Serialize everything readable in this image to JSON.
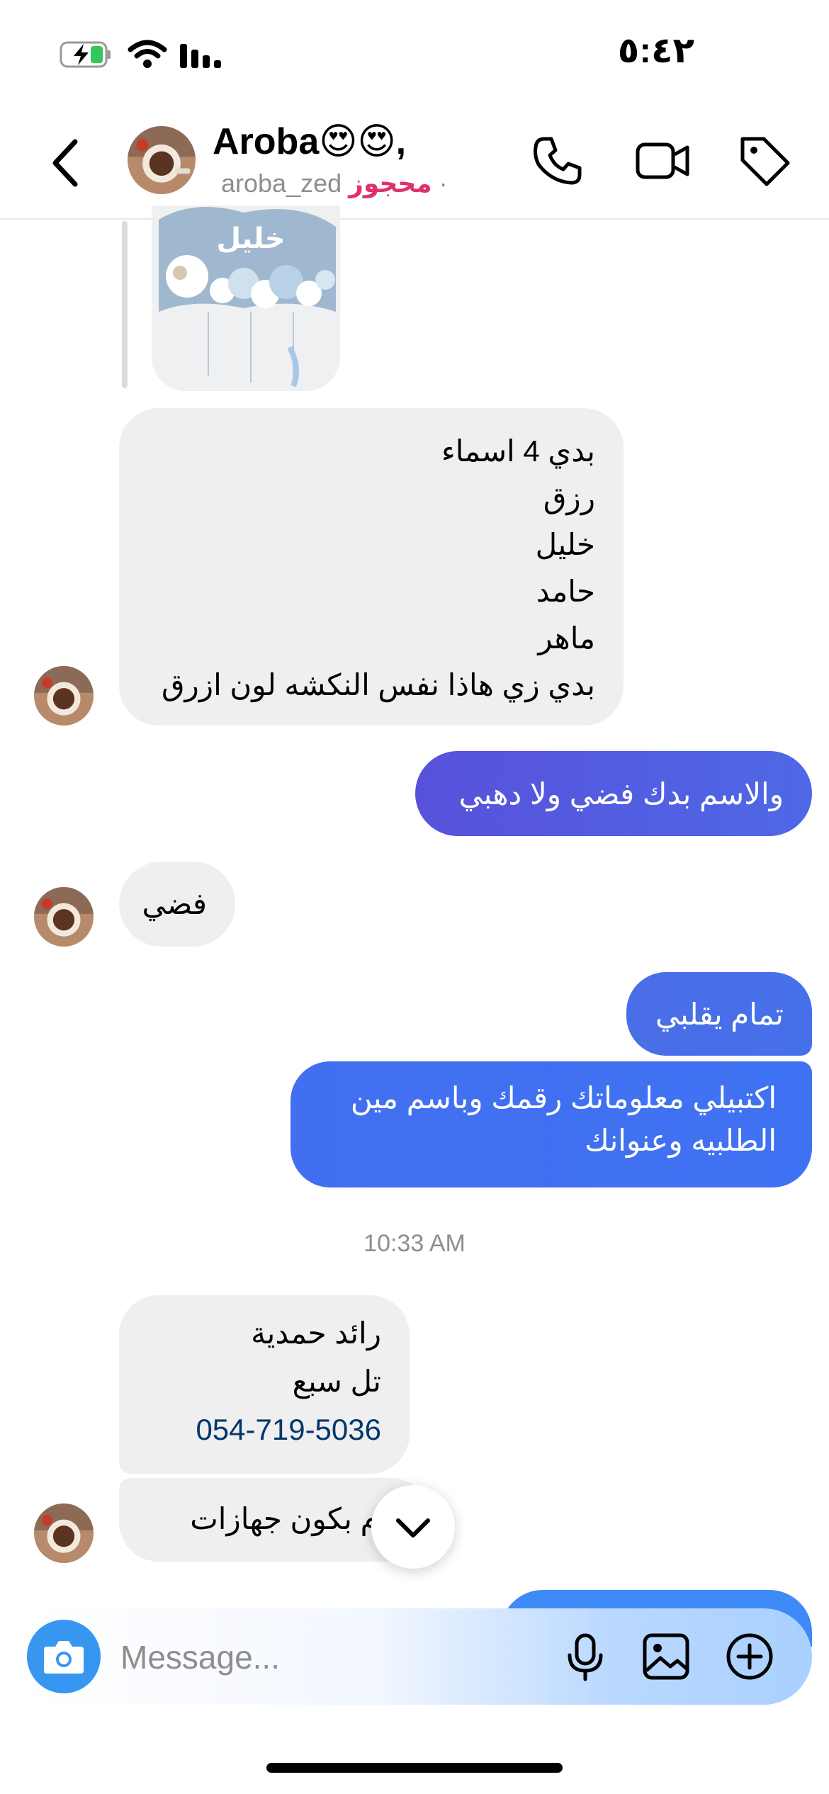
{
  "status_bar": {
    "time": "٥:٤٢",
    "battery_icon": "battery-charging-icon",
    "wifi_icon": "wifi-icon",
    "signal_icon": "signal-icon"
  },
  "header": {
    "name": "Aroba😍😍,",
    "username": "aroba_zed",
    "badge": "محجوز",
    "separator": "·",
    "icons": [
      "back-icon",
      "phone-icon",
      "video-icon",
      "tag-icon"
    ]
  },
  "shared_image": {
    "caption_text": "خليل"
  },
  "messages": [
    {
      "from": "them",
      "lines": [
        "بدي  4 اسماء",
        "رزق",
        "خليل",
        "حامد",
        "ماهر",
        "بدي زي هاذا نفس النكشه لون ازرق"
      ]
    },
    {
      "from": "me",
      "lines": [
        "والاسم بدك فضي ولا دهبي"
      ]
    },
    {
      "from": "them",
      "lines": [
        "فضي"
      ]
    },
    {
      "from": "me",
      "lines": [
        "تمام يقلبي"
      ]
    },
    {
      "from": "me",
      "lines": [
        "اكتبيلي معلوماتك رقمك وباسم مين",
        "الطلبيه وعنوانك"
      ]
    },
    {
      "from": "them",
      "lines": [
        "رائد حمدية",
        "تل سبع"
      ],
      "phone": "054-719-5036"
    },
    {
      "from": "them",
      "lines": [
        "يوم بكون جهازات"
      ]
    }
  ],
  "timestamp": "10:33 AM",
  "composer": {
    "placeholder": "Message..."
  },
  "colors": {
    "outgoing_start": "#5851db",
    "outgoing_end": "#3e8af7",
    "incoming": "#efefef",
    "badge": "#e1306c",
    "link": "#00376b"
  }
}
